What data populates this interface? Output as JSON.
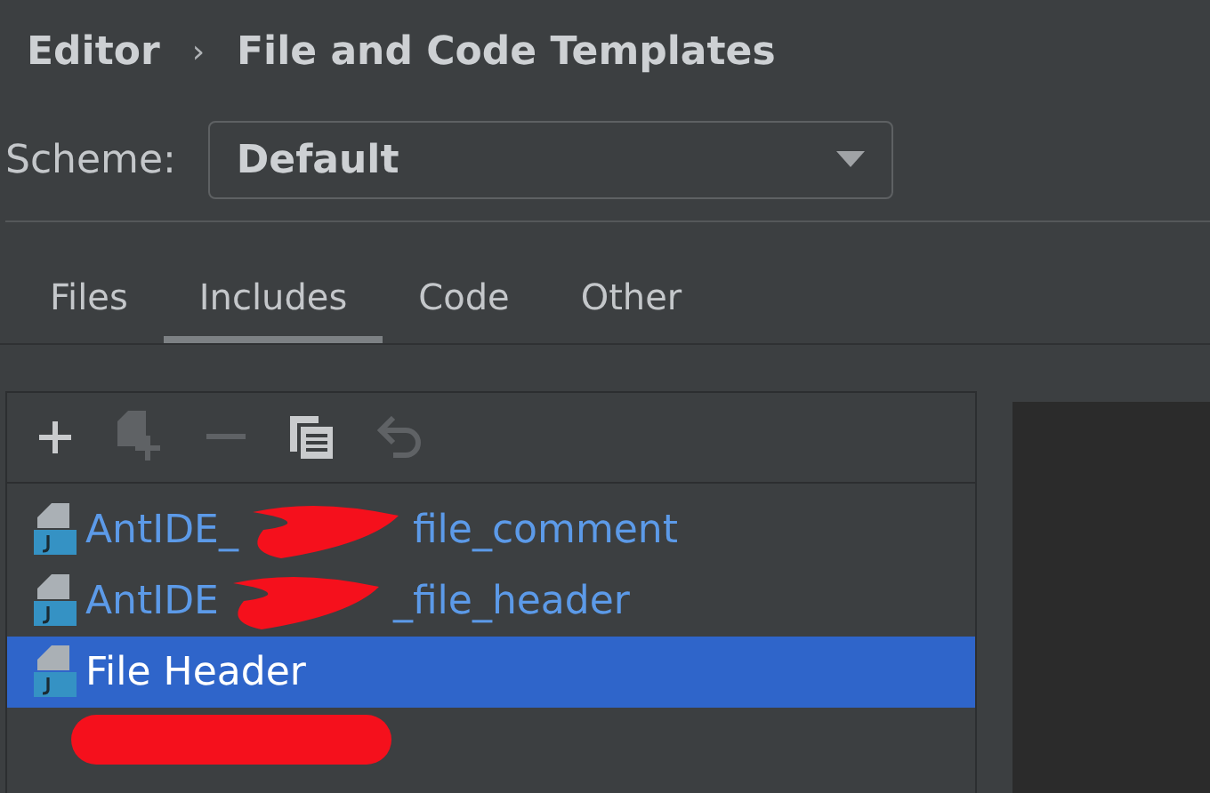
{
  "breadcrumb": {
    "parent": "Editor",
    "separator": "›",
    "current": "File and Code Templates"
  },
  "scheme": {
    "label": "Scheme:",
    "value": "Default"
  },
  "tabs": [
    {
      "label": "Files",
      "selected": false
    },
    {
      "label": "Includes",
      "selected": true
    },
    {
      "label": "Code",
      "selected": false
    },
    {
      "label": "Other",
      "selected": false
    }
  ],
  "toolbar": [
    {
      "kind": "add",
      "disabled": false
    },
    {
      "kind": "add-child",
      "disabled": true
    },
    {
      "kind": "remove",
      "disabled": true
    },
    {
      "kind": "copy",
      "disabled": false
    },
    {
      "kind": "reset",
      "disabled": true
    }
  ],
  "templates": [
    {
      "prefix": "AntIDE_",
      "suffix": "file_comment",
      "redacted": true,
      "selected": false
    },
    {
      "prefix": "AntIDE",
      "suffix": "_file_header",
      "redacted": true,
      "selected": false
    },
    {
      "prefix": "File Header",
      "selected": true
    }
  ],
  "below_list_redacted": true
}
